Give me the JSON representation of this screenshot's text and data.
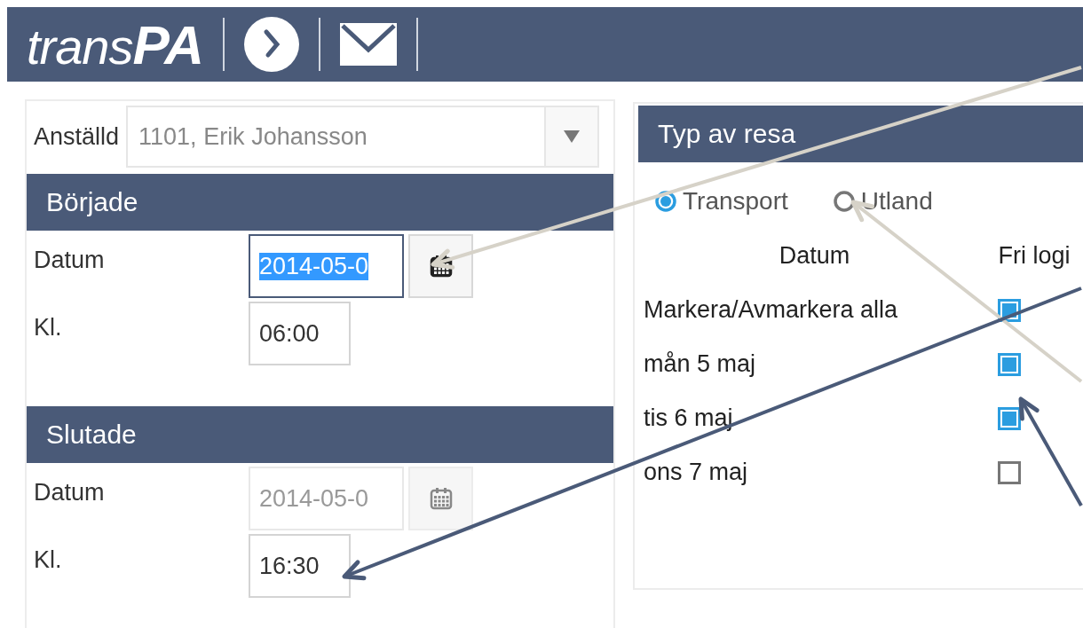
{
  "header": {
    "logo": {
      "light": "trans",
      "bold": "PA"
    }
  },
  "employee": {
    "label": "Anställd",
    "value": "1101, Erik  Johansson"
  },
  "sections": [
    {
      "title": "Började",
      "fields": [
        {
          "label": "Datum",
          "kind": "date",
          "value": "2014-05-0",
          "selected": true,
          "disabled": false
        },
        {
          "label": "Kl.",
          "kind": "time",
          "value": "06:00",
          "selected": false,
          "disabled": false
        }
      ]
    },
    {
      "title": "Slutade",
      "fields": [
        {
          "label": "Datum",
          "kind": "date",
          "value": "2014-05-0",
          "selected": false,
          "disabled": true
        },
        {
          "label": "Kl.",
          "kind": "time",
          "value": "16:30",
          "selected": false,
          "disabled": false
        }
      ]
    }
  ],
  "trip": {
    "title": "Typ av resa",
    "options": [
      {
        "label": "Transport",
        "selected": true
      },
      {
        "label": "Utland",
        "selected": false
      }
    ],
    "columns": [
      "Datum",
      "Fri logi"
    ],
    "rows": [
      {
        "label": "Markera/Avmarkera alla",
        "checked": true
      },
      {
        "label": "mån 5 maj",
        "checked": true
      },
      {
        "label": "tis 6 maj",
        "checked": true
      },
      {
        "label": "ons 7 maj",
        "checked": false
      }
    ]
  }
}
